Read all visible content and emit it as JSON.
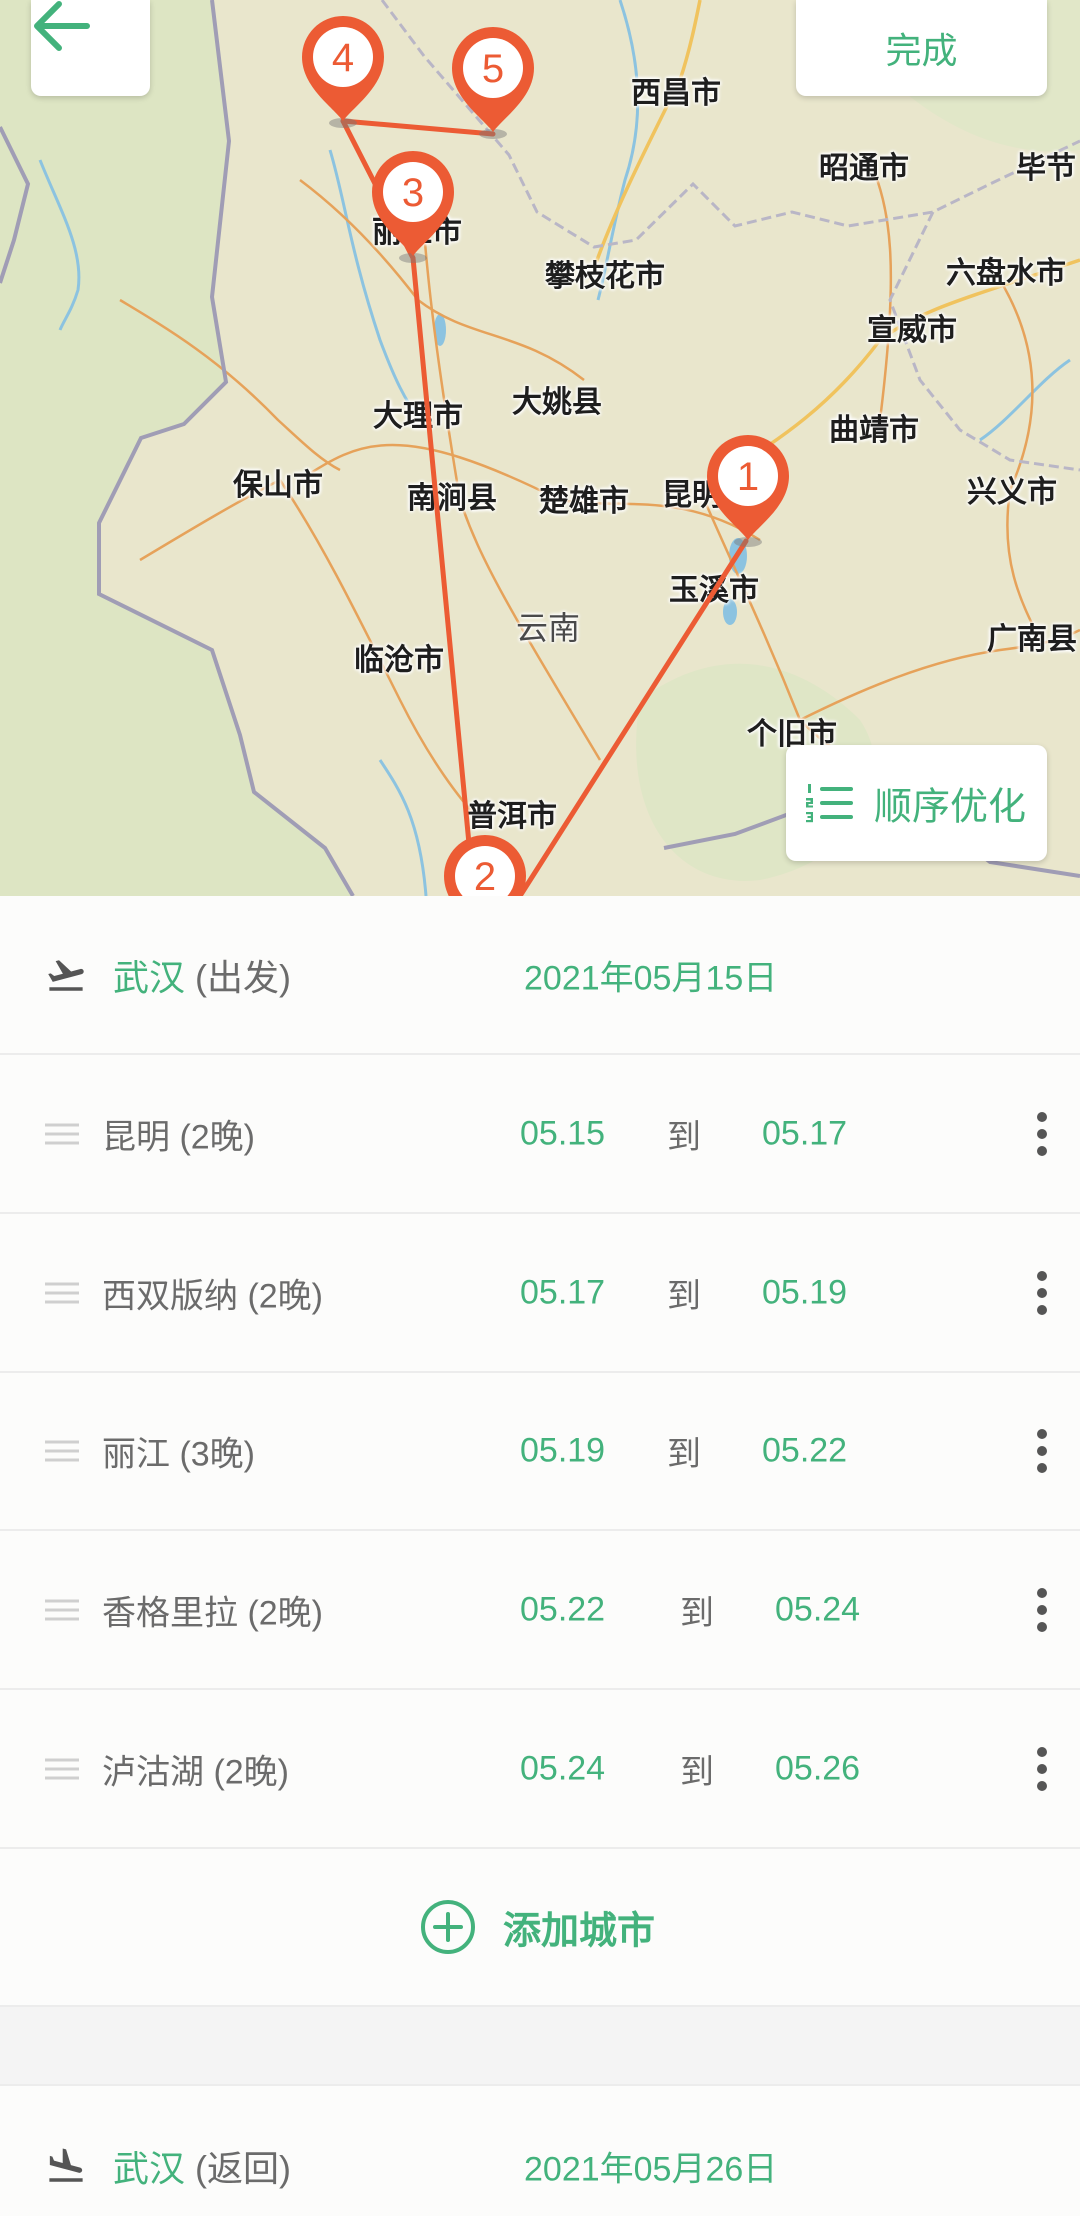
{
  "app": {
    "back_icon": "arrow-left-icon",
    "done_label": "完成"
  },
  "map": {
    "labels": [
      "西昌市",
      "昭通市",
      "毕节",
      "丽江市",
      "攀枝花市",
      "六盘水市",
      "宣威市",
      "大理市",
      "大姚县",
      "曲靖市",
      "保山市",
      "南涧县",
      "楚雄市",
      "昆明市",
      "兴义市",
      "玉溪市",
      "云南",
      "临沧市",
      "广南县",
      "个旧市",
      "普洱市"
    ],
    "markers": [
      "1",
      "2",
      "3",
      "4",
      "5"
    ],
    "optimize": {
      "label": "顺序优化",
      "icon": "numbered-list-icon"
    }
  },
  "departure": {
    "icon": "plane-takeoff-icon",
    "city": "武汉",
    "tag": "(出发)",
    "date": "2021年05月15日"
  },
  "stops": [
    {
      "name": "昆明 (2晚)",
      "from": "05.15",
      "to": "05.17"
    },
    {
      "name": "西双版纳 (2晚)",
      "from": "05.17",
      "to": "05.19"
    },
    {
      "name": "丽江 (3晚)",
      "from": "05.19",
      "to": "05.22"
    },
    {
      "name": "香格里拉 (2晚)",
      "from": "05.22",
      "to": "05.24"
    },
    {
      "name": "泸沽湖 (2晚)",
      "from": "05.24",
      "to": "05.26"
    }
  ],
  "stop_separator": "到",
  "stop_icons": {
    "drag": "drag-handle-icon",
    "more": "more-vertical-icon"
  },
  "add_city": {
    "icon": "plus-circle-icon",
    "label": "添加城市"
  },
  "return_trip": {
    "icon": "plane-landing-icon",
    "city": "武汉",
    "tag": "(返回)",
    "date": "2021年05月26日"
  },
  "colors": {
    "accent": "#43b27c",
    "route": "#ec5b34",
    "text_muted": "#6b6b6b",
    "map_land": "#e9e6cc"
  }
}
